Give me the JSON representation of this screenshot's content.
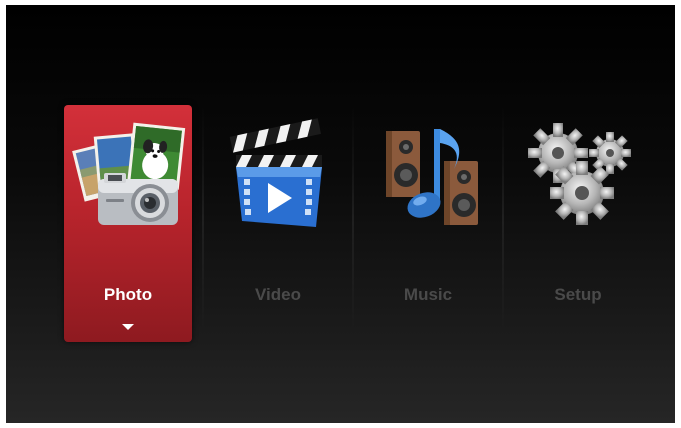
{
  "menu": {
    "items": [
      {
        "label": "Photo",
        "icon": "photo-camera-icon",
        "selected": true
      },
      {
        "label": "Video",
        "icon": "clapperboard-icon",
        "selected": false
      },
      {
        "label": "Music",
        "icon": "speakers-music-note-icon",
        "selected": false
      },
      {
        "label": "Setup",
        "icon": "gears-icon",
        "selected": false
      }
    ]
  },
  "colors": {
    "selected_tile": "#b8242c",
    "background": "#000000",
    "unselected_label": "#4a4a4a",
    "selected_label": "#ffffff"
  }
}
